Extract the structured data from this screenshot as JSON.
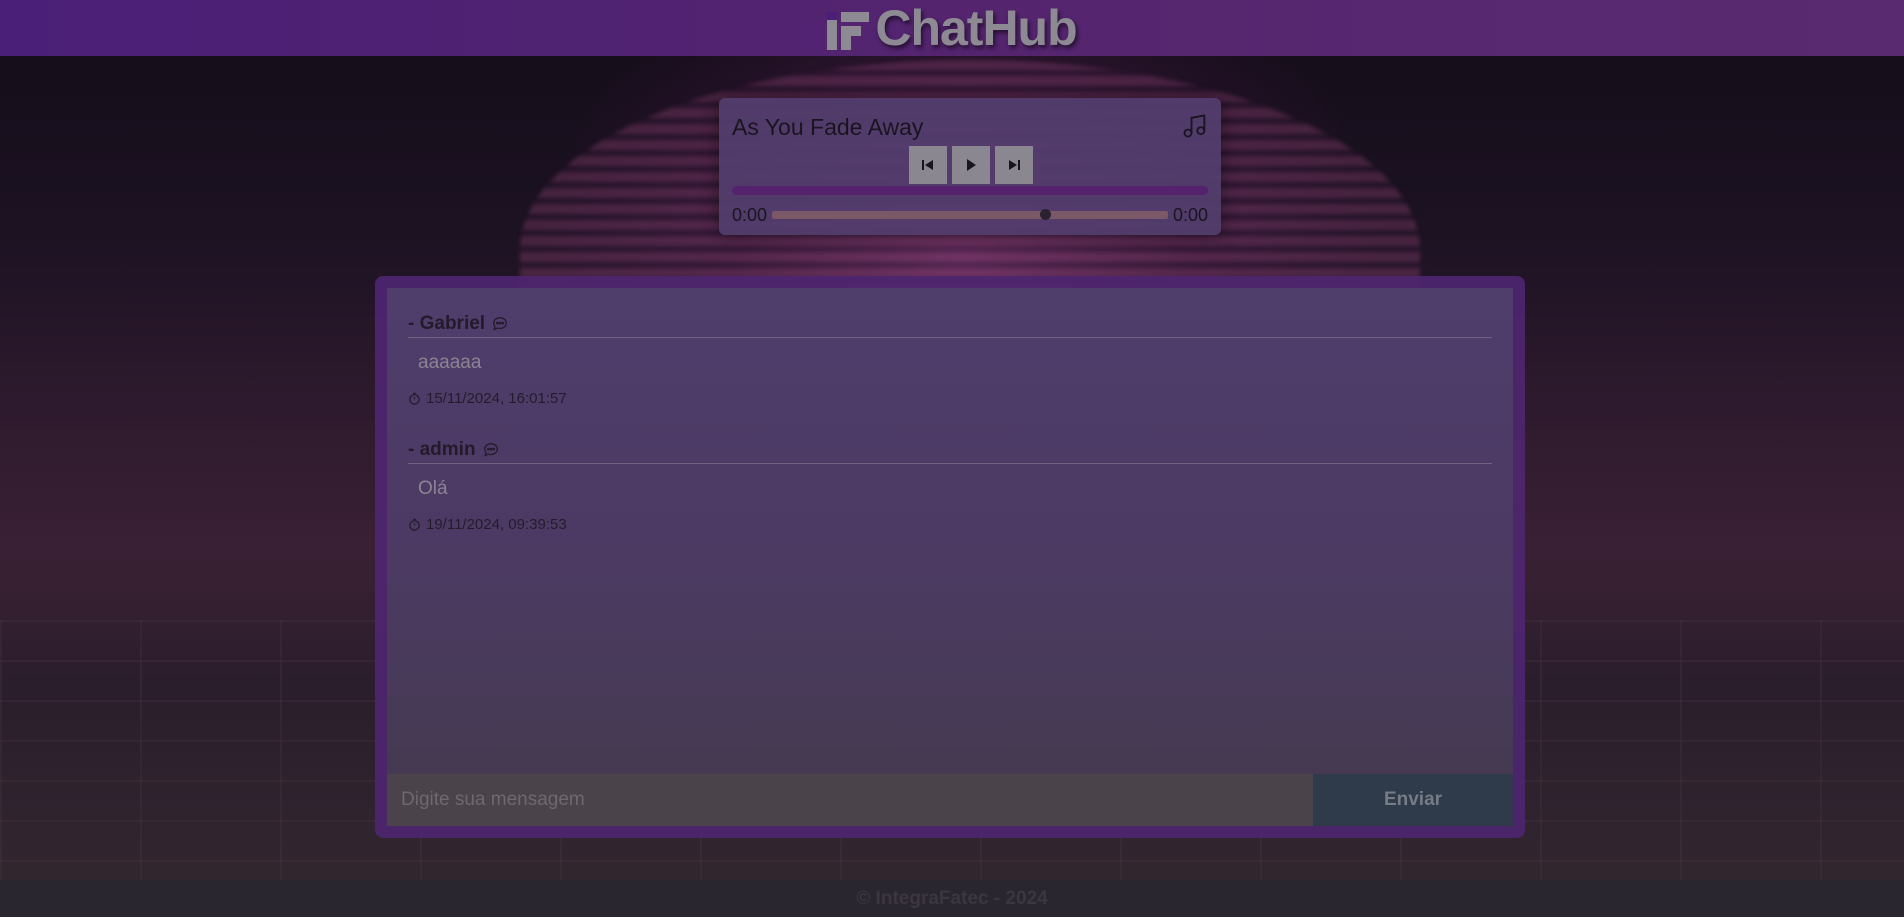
{
  "header": {
    "brand_title": "ChatHub",
    "logo_icon": "integrafatec-logo"
  },
  "player": {
    "track_title": "As You Fade Away",
    "icon": "music-note-icon",
    "buttons": {
      "previous": "skip-previous-icon",
      "play": "play-icon",
      "next": "skip-next-icon"
    },
    "current_time": "0:00",
    "duration": "0:00",
    "seek_position_fraction": 0.69,
    "accent_color": "#55226d"
  },
  "chat": {
    "messages": [
      {
        "user": "- Gabriel",
        "text": "aaaaaa",
        "timestamp": "15/11/2024, 16:01:57"
      },
      {
        "user": "- admin",
        "text": "Olá",
        "timestamp": "19/11/2024, 09:39:53"
      }
    ],
    "input_placeholder": "Digite sua mensagem",
    "input_value": "",
    "send_label": "Enviar"
  },
  "footer": {
    "text": "© IntegraFatec - 2024"
  }
}
